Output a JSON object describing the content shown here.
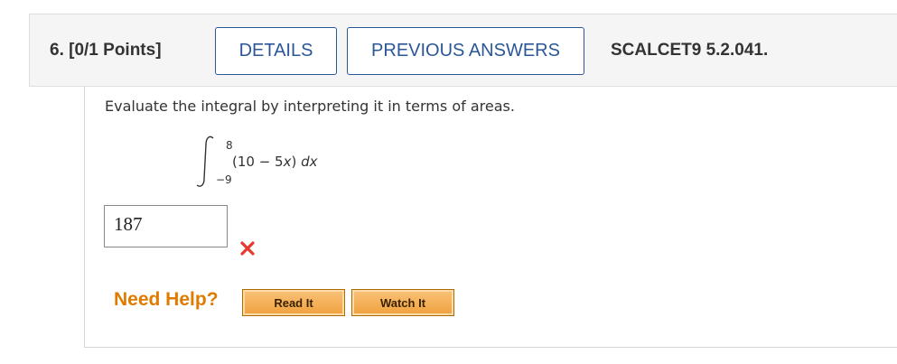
{
  "question": {
    "number_points": "6. [0/1 Points]",
    "details_label": "DETAILS",
    "previous_answers_label": "PREVIOUS ANSWERS",
    "source_code": "SCALCET9 5.2.041."
  },
  "problem": {
    "prompt": "Evaluate the integral by interpreting it in terms of areas.",
    "integral": {
      "upper_limit": "8",
      "lower_limit": "−9",
      "expression_open": "(10 − 5",
      "variable": "x",
      "expression_close": ") ",
      "differential": "dx"
    }
  },
  "answer": {
    "value": "187",
    "status": "incorrect",
    "status_icon": "x-mark-icon",
    "status_color": "#e8392e"
  },
  "help": {
    "label": "Need Help?",
    "read_it_label": "Read It",
    "watch_it_label": "Watch It",
    "label_color": "#e07b00"
  },
  "colors": {
    "accent": "#2b5797",
    "header_bg": "#f5f5f5"
  }
}
